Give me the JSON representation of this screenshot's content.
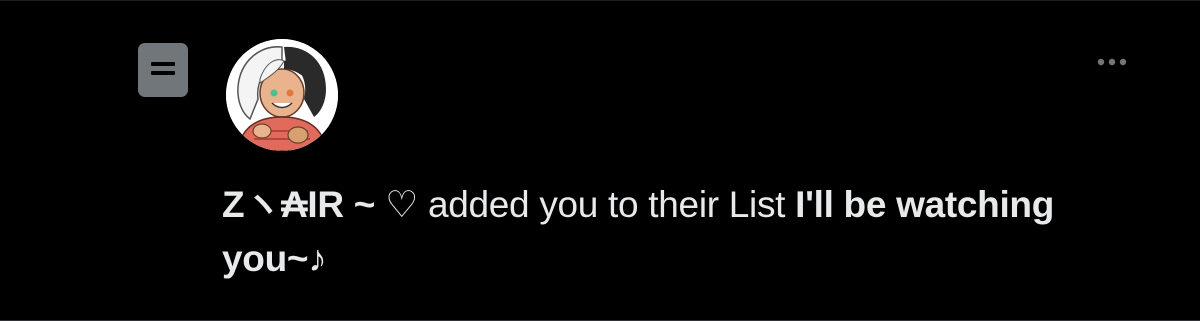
{
  "notification": {
    "type_icon": "list-icon",
    "avatar_icon": "avatar-illustration",
    "more_icon": "more-horizontal-icon",
    "user_name": "Zヽ₳IR ~ ♡",
    "action_text": " added you to their List ",
    "list_name": "I'll be watching you~♪"
  },
  "colors": {
    "background": "#000000",
    "text": "#e7e9ea",
    "icon_gray": "#71767b"
  }
}
